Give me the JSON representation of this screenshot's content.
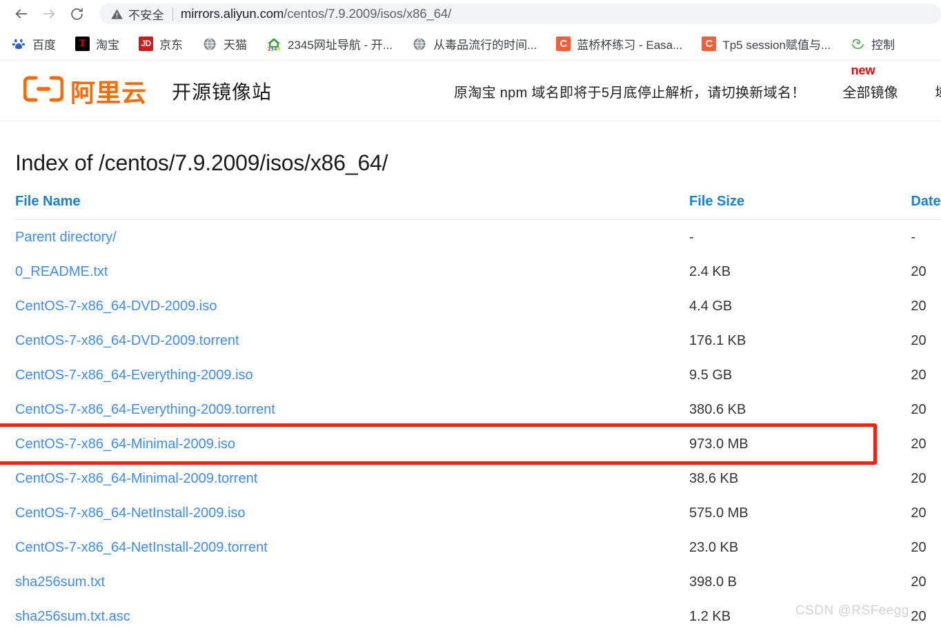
{
  "browser": {
    "back_icon": "back-arrow-icon",
    "forward_icon": "forward-arrow-icon",
    "reload_icon": "reload-icon",
    "security_icon": "warning-triangle-icon",
    "security_label": "不安全",
    "url_host": "mirrors.aliyun.com",
    "url_path": "/centos/7.9.2009/isos/x86_64/",
    "url_full": "mirrors.aliyun.com/centos/7.9.2009/isos/x86_64/"
  },
  "bookmarks": [
    {
      "label": "百度",
      "icon": "baidu-paw-icon",
      "glyph": "熊"
    },
    {
      "label": "淘宝",
      "icon": "taobao-icon",
      "glyph": "T"
    },
    {
      "label": "京东",
      "icon": "jd-icon",
      "glyph": "JD"
    },
    {
      "label": "天猫",
      "icon": "globe-icon",
      "glyph": ""
    },
    {
      "label": "2345网址导航 - 开...",
      "icon": "2345-house-icon",
      "glyph": "2345"
    },
    {
      "label": "从毒品流行的时间...",
      "icon": "globe-icon",
      "glyph": ""
    },
    {
      "label": "蓝桥杯练习 - Easa...",
      "icon": "csdn-c-icon",
      "glyph": "C"
    },
    {
      "label": "Tp5 session赋值与...",
      "icon": "csdn-c-icon",
      "glyph": "C"
    },
    {
      "label": "控制",
      "icon": "green-leaf-icon",
      "glyph": ""
    }
  ],
  "site": {
    "logo_text": "阿里云",
    "logo_mark": "aliyun-logo-icon",
    "title": "开源镜像站",
    "notice": "原淘宝 npm 域名即将于5月底停止解析，请切换新域名！",
    "nav": [
      {
        "label": "全部镜像",
        "badge": "new"
      },
      {
        "label": "域名",
        "badge": ""
      }
    ]
  },
  "page": {
    "title": "Index of /centos/7.9.2009/isos/x86_64/",
    "columns": [
      "File Name",
      "File Size",
      "Date"
    ],
    "rows": [
      {
        "name": "Parent directory/",
        "size": "-",
        "date": "-"
      },
      {
        "name": "0_README.txt",
        "size": "2.4 KB",
        "date": "20"
      },
      {
        "name": "CentOS-7-x86_64-DVD-2009.iso",
        "size": "4.4 GB",
        "date": "20"
      },
      {
        "name": "CentOS-7-x86_64-DVD-2009.torrent",
        "size": "176.1 KB",
        "date": "20"
      },
      {
        "name": "CentOS-7-x86_64-Everything-2009.iso",
        "size": "9.5 GB",
        "date": "20"
      },
      {
        "name": "CentOS-7-x86_64-Everything-2009.torrent",
        "size": "380.6 KB",
        "date": "20"
      },
      {
        "name": "CentOS-7-x86_64-Minimal-2009.iso",
        "size": "973.0 MB",
        "date": "20"
      },
      {
        "name": "CentOS-7-x86_64-Minimal-2009.torrent",
        "size": "38.6 KB",
        "date": "20"
      },
      {
        "name": "CentOS-7-x86_64-NetInstall-2009.iso",
        "size": "575.0 MB",
        "date": "20"
      },
      {
        "name": "CentOS-7-x86_64-NetInstall-2009.torrent",
        "size": "23.0 KB",
        "date": "20"
      },
      {
        "name": "sha256sum.txt",
        "size": "398.0 B",
        "date": "20"
      },
      {
        "name": "sha256sum.txt.asc",
        "size": "1.2 KB",
        "date": "20"
      }
    ],
    "highlighted_row_index": 6
  },
  "watermark": "CSDN @RSFeegg",
  "colors": {
    "link": "#3d8bfd",
    "header_link": "#1681d4",
    "highlight": "#fa1e0e",
    "brand_orange": "#ff6a00",
    "badge_red": "#ff0000"
  }
}
